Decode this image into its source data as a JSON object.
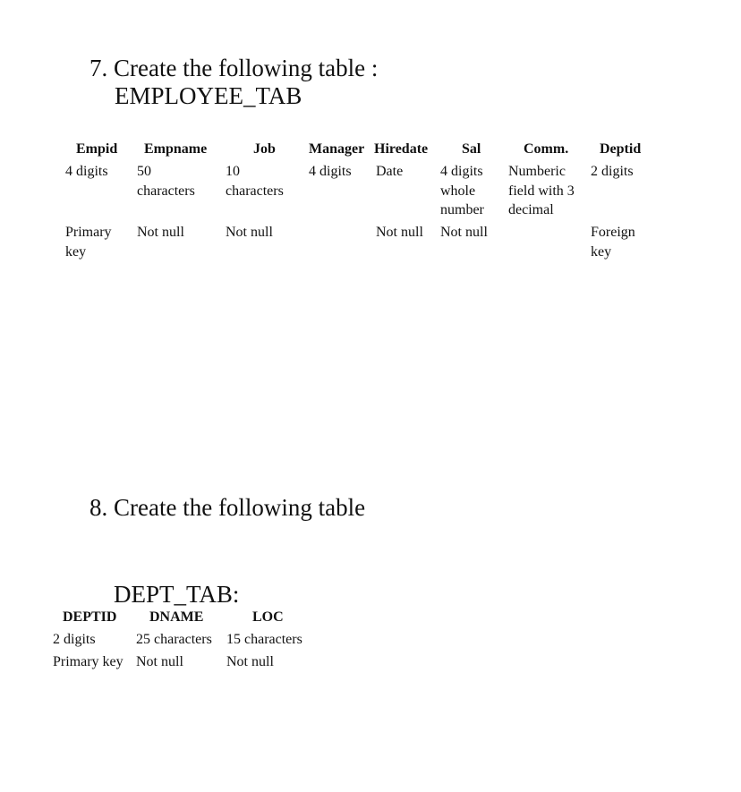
{
  "question7": {
    "heading": "7. Create the following table :",
    "table_name": "EMPLOYEE_TAB",
    "columns": [
      {
        "header": "Empid",
        "type_lines": [
          "4 digits"
        ],
        "constraint_lines": [
          "Primary",
          "key"
        ]
      },
      {
        "header": "Empname",
        "type_lines": [
          "50",
          "characters"
        ],
        "constraint_lines": [
          "Not null"
        ]
      },
      {
        "header": "Job",
        "type_lines": [
          "10",
          "characters"
        ],
        "constraint_lines": [
          "Not null"
        ]
      },
      {
        "header": "Manager",
        "type_lines": [
          "4 digits"
        ],
        "constraint_lines": []
      },
      {
        "header": "Hiredate",
        "type_lines": [
          "Date"
        ],
        "constraint_lines": [
          "Not null"
        ]
      },
      {
        "header": "Sal",
        "type_lines": [
          "4 digits",
          "whole",
          "number"
        ],
        "constraint_lines": [
          "Not null"
        ]
      },
      {
        "header": "Comm.",
        "type_lines": [
          "Numberic",
          "field with 3",
          "decimal"
        ],
        "constraint_lines": []
      },
      {
        "header": "Deptid",
        "type_lines": [
          "2 digits"
        ],
        "constraint_lines": [
          "Foreign",
          "key"
        ]
      }
    ]
  },
  "question8": {
    "heading": "8. Create the following table",
    "table_name": "DEPT_TAB:",
    "columns": [
      {
        "header": "DEPTID",
        "type": "2 digits",
        "constraint": "Primary key"
      },
      {
        "header": "DNAME",
        "type": "25 characters",
        "constraint": "Not null"
      },
      {
        "header": "LOC",
        "type": "15 characters",
        "constraint": "Not null"
      }
    ]
  }
}
